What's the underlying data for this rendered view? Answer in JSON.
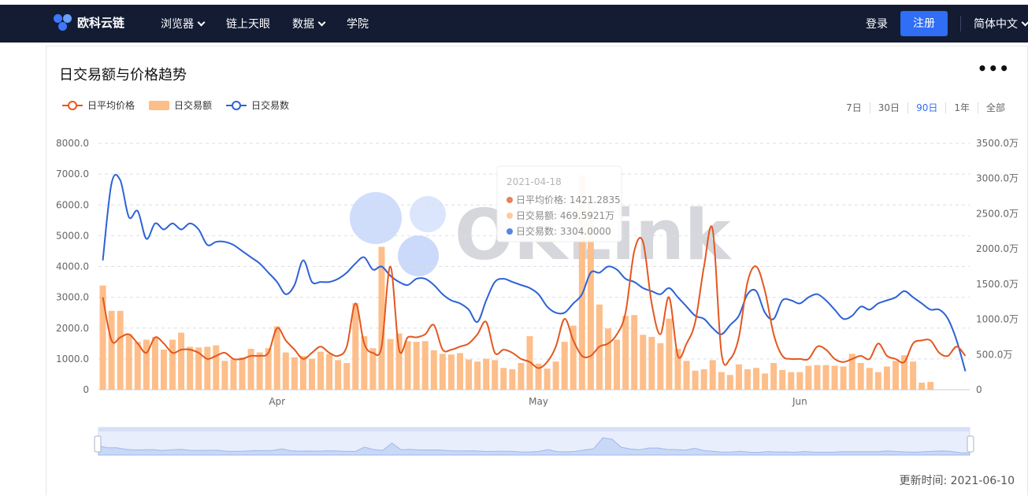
{
  "nav": {
    "brand": "欧科云链",
    "items": [
      {
        "label": "浏览器",
        "dropdown": true
      },
      {
        "label": "链上天眼",
        "dropdown": false
      },
      {
        "label": "数据",
        "dropdown": true
      },
      {
        "label": "学院",
        "dropdown": false
      }
    ],
    "login": "登录",
    "register": "注册",
    "language": "简体中文"
  },
  "colors": {
    "nav_bg": "#131c33",
    "accent": "#2f6ef5",
    "price_line": "#e4571f",
    "volume_bar": "#fdbe8a",
    "tx_count_line": "#2c62d6"
  },
  "card": {
    "title": "日交易额与价格趋势",
    "more_icon": "more-dots-icon",
    "ranges": [
      "7日",
      "30日",
      "90日",
      "1年",
      "全部"
    ],
    "active_range": "90日",
    "updated": "更新时间: 2021-06-10",
    "watermark": "OKLink"
  },
  "chart_data": {
    "type": "bar",
    "grid": true,
    "legend_position": "top-left",
    "x_tick_labels": [
      "Apr",
      "May",
      "Jun"
    ],
    "x_tick_index": [
      20,
      50,
      80
    ],
    "y_left": {
      "min": 0,
      "max": 8000,
      "ticks": [
        "0",
        "1000.0",
        "2000.0",
        "3000.0",
        "4000.0",
        "5000.0",
        "6000.0",
        "7000.0",
        "8000.0"
      ]
    },
    "y_right": {
      "min": 0,
      "max": 3500,
      "ticks": [
        "0",
        "500.0万",
        "1000.0万",
        "1500.0万",
        "2000.0万",
        "2500.0万",
        "3000.0万",
        "3500.0万"
      ]
    },
    "series": [
      {
        "name": "日平均价格",
        "kind": "line",
        "axis": "left",
        "values": [
          3000,
          1600,
          1700,
          1800,
          1500,
          1200,
          1700,
          1500,
          1200,
          1300,
          1300,
          1200,
          1000,
          1100,
          1200,
          1000,
          1000,
          1100,
          1100,
          1200,
          2000,
          1600,
          1300,
          1000,
          1200,
          1400,
          1200,
          1100,
          1400,
          2800,
          1500,
          1200,
          1400,
          4000,
          1300,
          1700,
          1700,
          1800,
          2100,
          1300,
          1300,
          1400,
          1500,
          1800,
          2200,
          1200,
          1300,
          1200,
          1000,
          900,
          700,
          900,
          1400,
          2300,
          1600,
          1100,
          1100,
          1400,
          1500,
          1800,
          2500,
          4500,
          4800,
          2800,
          1800,
          3000,
          1100,
          1500,
          2200,
          4000,
          5200,
          1200,
          1000,
          1700,
          3500,
          4000,
          3200,
          1800,
          1100,
          1000,
          1000,
          1000,
          1400,
          1300,
          1000,
          900,
          1000,
          1100,
          1000,
          1500,
          1100,
          1000,
          900,
          1500,
          1600,
          1600,
          1200,
          1100,
          1400,
          1100
        ]
      },
      {
        "name": "日交易额",
        "kind": "bar",
        "axis": "right",
        "values": [
          1480,
          1120,
          1120,
          790,
          680,
          710,
          750,
          570,
          710,
          810,
          610,
          600,
          610,
          630,
          410,
          430,
          460,
          580,
          530,
          590,
          900,
          530,
          460,
          480,
          440,
          540,
          510,
          420,
          380,
          1230,
          760,
          590,
          2030,
          720,
          800,
          690,
          680,
          690,
          560,
          510,
          500,
          520,
          430,
          400,
          440,
          420,
          310,
          290,
          380,
          760,
          370,
          300,
          400,
          680,
          910,
          3050,
          2760,
          1210,
          870,
          710,
          1050,
          1060,
          780,
          750,
          660,
          1010,
          580,
          410,
          270,
          290,
          420,
          250,
          210,
          360,
          290,
          310,
          230,
          380,
          280,
          250,
          250,
          340,
          350,
          350,
          340,
          330,
          510,
          380,
          310,
          250,
          330,
          410,
          490,
          400,
          100,
          110
        ]
      },
      {
        "name": "日交易数",
        "kind": "line",
        "axis": "left",
        "values": [
          4200,
          6700,
          6800,
          5600,
          5800,
          4900,
          5400,
          5200,
          5400,
          5200,
          5400,
          5200,
          4700,
          4800,
          4800,
          4700,
          4500,
          4300,
          4100,
          3800,
          3500,
          3100,
          3400,
          4200,
          3500,
          3500,
          3500,
          3600,
          3800,
          4100,
          4300,
          3900,
          4000,
          3700,
          3500,
          3400,
          3600,
          3600,
          3400,
          3100,
          2900,
          2800,
          2600,
          2200,
          2900,
          3500,
          3600,
          3500,
          3400,
          3300,
          3100,
          2700,
          2500,
          2500,
          2800,
          3100,
          3800,
          3800,
          4000,
          3900,
          3600,
          3500,
          3300,
          3200,
          3100,
          3300,
          3000,
          2700,
          2400,
          2300,
          2000,
          1800,
          2100,
          2400,
          3100,
          3200,
          2500,
          2300,
          2900,
          2900,
          2800,
          3000,
          3100,
          2900,
          2600,
          2300,
          2400,
          2700,
          2600,
          2800,
          2900,
          3000,
          3200,
          3000,
          2800,
          2600,
          2600,
          2300,
          1600,
          600
        ]
      }
    ],
    "tooltip": {
      "date": "2021-04-18",
      "rows": [
        {
          "label": "日平均价格: 1421.2835",
          "color": "#e8825a"
        },
        {
          "label": "日交易额: 469.5921万",
          "color": "#fcc9a0"
        },
        {
          "label": "日交易数: 3304.0000",
          "color": "#5b84e0"
        }
      ]
    }
  }
}
